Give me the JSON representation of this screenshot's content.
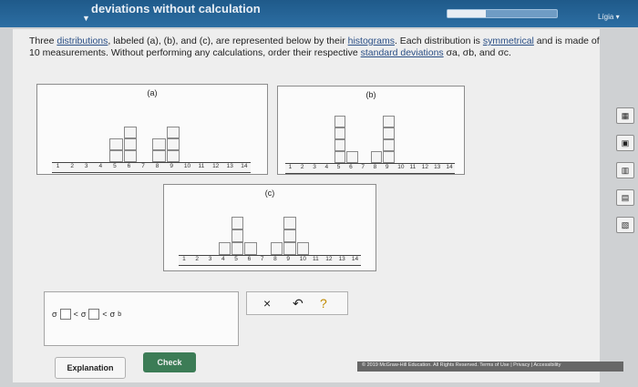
{
  "header": {
    "title": "deviations without calculation",
    "dropdown_symbol": "▼",
    "progress_fraction": 0.35,
    "language_label": "Lígia ▾"
  },
  "question": {
    "text_1": "Three ",
    "link_distributions": "distributions",
    "text_2": ", labeled (a), (b), and (c), are represented below by their ",
    "link_histograms": "histograms",
    "text_3": ". Each distribution is ",
    "link_symmetrical": "symmetrical",
    "text_4": " and is made of 10 measurements. Without performing any calculations, order their respective ",
    "link_std": "standard deviations",
    "text_5": " σa, σb, and σc."
  },
  "plots": {
    "a": {
      "label": "(a)",
      "ticks": [
        "1",
        "2",
        "3",
        "4",
        "5",
        "6",
        "7",
        "8",
        "9",
        "10",
        "11",
        "12",
        "13",
        "14"
      ],
      "bars": [
        0,
        0,
        0,
        0,
        2,
        3,
        0,
        2,
        3,
        0,
        0,
        0,
        0,
        0
      ]
    },
    "b": {
      "label": "(b)",
      "ticks": [
        "1",
        "2",
        "3",
        "4",
        "5",
        "6",
        "7",
        "8",
        "9",
        "10",
        "11",
        "12",
        "13",
        "14"
      ],
      "bars": [
        0,
        0,
        0,
        0,
        4,
        1,
        0,
        1,
        4,
        0,
        0,
        0,
        0,
        0
      ]
    },
    "c": {
      "label": "(c)",
      "ticks": [
        "1",
        "2",
        "3",
        "4",
        "5",
        "6",
        "7",
        "8",
        "9",
        "10",
        "11",
        "12",
        "13",
        "14"
      ],
      "bars": [
        0,
        0,
        0,
        1,
        3,
        1,
        0,
        1,
        3,
        1,
        0,
        0,
        0,
        0
      ]
    }
  },
  "answer": {
    "sigma": "σ",
    "less_than": "<",
    "sub_b": "b"
  },
  "tools": {
    "clear": "×",
    "undo": "↶",
    "help": "?"
  },
  "buttons": {
    "explanation": "Explanation",
    "check": "Check"
  },
  "footer": {
    "text": "© 2019 McGraw-Hill Education. All Rights Reserved.   Terms of Use   |   Privacy   |   Accessibility"
  },
  "side_icons": [
    "▦",
    "▣",
    "▥",
    "▤",
    "▧"
  ]
}
